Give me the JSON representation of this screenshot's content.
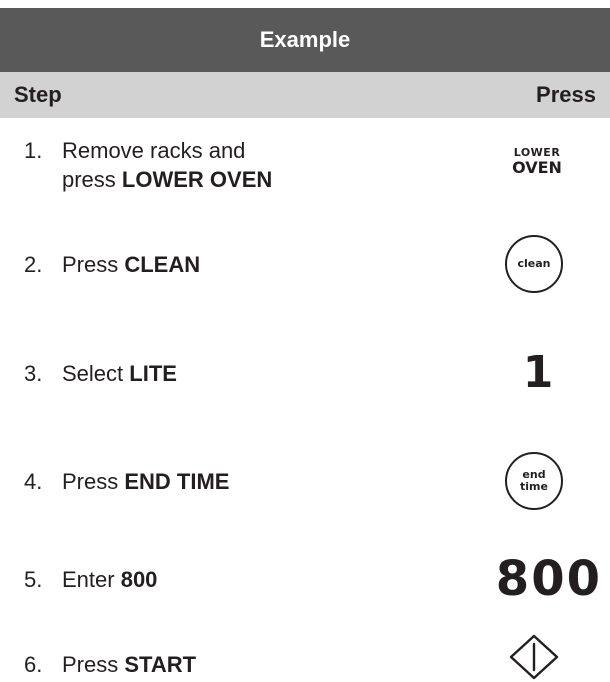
{
  "table": {
    "title": "Example",
    "col_step": "Step",
    "col_press": "Press"
  },
  "steps": [
    {
      "num": "1.",
      "line1": "Remove racks and",
      "prefix": "press ",
      "bold": "LOWER OVEN"
    },
    {
      "num": "2.",
      "prefix": "Press ",
      "bold": "CLEAN"
    },
    {
      "num": "3.",
      "prefix": "Select ",
      "bold": "LITE"
    },
    {
      "num": "4.",
      "prefix": "Press ",
      "bold": "END TIME"
    },
    {
      "num": "5.",
      "prefix": "Enter ",
      "bold": "800"
    },
    {
      "num": "6.",
      "prefix": "Press ",
      "bold": "START"
    }
  ],
  "keys": {
    "lower_oven_top": "LOWER",
    "lower_oven_bottom": "OVEN",
    "clean": "clean",
    "one": "1",
    "end_time_top": "end",
    "end_time_bottom": "time",
    "digits": "800",
    "start_icon": "start-diamond-icon"
  }
}
